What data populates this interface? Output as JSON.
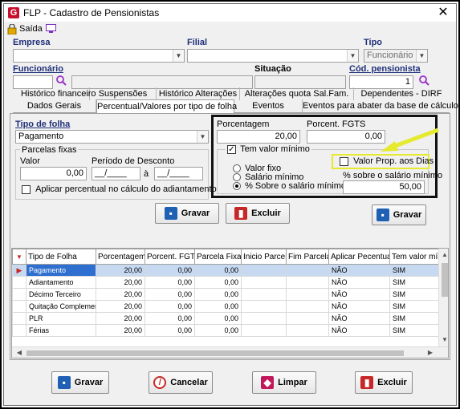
{
  "window": {
    "title": "FLP - Cadastro de Pensionistas",
    "app_icon": "G",
    "close": "✕"
  },
  "toolbar": {
    "exit_label": "Saída"
  },
  "header": {
    "empresa_label": "Empresa",
    "filial_label": "Filial",
    "tipo_label": "Tipo",
    "tipo_value": "Funcionário",
    "funcionario_label": "Funcionário",
    "situacao_label": "Situação",
    "cod_pensionista_label": "Cód. pensionista",
    "cod_pensionista_value": "1"
  },
  "tabs_row1": [
    "Histórico financeiro",
    "Suspensões",
    "Histórico Alterações",
    "Alterações quota Sal.Fam.",
    "Dependentes - DIRF"
  ],
  "tabs_row2": [
    "Dados Gerais",
    "Percentual/Valores por tipo de folha",
    "Eventos",
    "Eventos para abater da base de cálculo"
  ],
  "form": {
    "tipo_folha_label": "Tipo de folha",
    "tipo_folha_value": "Pagamento",
    "parcelas_fixas_label": "Parcelas fixas",
    "valor_label": "Valor",
    "valor_value": "0,00",
    "periodo_label": "Período de Desconto",
    "periodo_de": "__/____",
    "periodo_sep": "à",
    "periodo_ate": "__/____",
    "aplicar_percentual_label": "Aplicar percentual no cálculo do adiantamento",
    "porcentagem_label": "Porcentagem",
    "porcentagem_value": "20,00",
    "porcent_fgts_label": "Porcent. FGTS",
    "porcent_fgts_value": "0,00",
    "tem_valor_minimo_label": "Tem valor mínimo",
    "valor_fixo_label": "Valor fixo",
    "salario_minimo_label": "Salário mínimo",
    "pct_sobre_salario_label": "% Sobre o salário mínimo",
    "valor_prop_dias_label": "Valor Prop. aos Dias",
    "pct_sobre_salario_minimo_label": "% sobre o salário mínimo",
    "pct_sobre_salario_minimo_value": "50,00",
    "gravar_label": "Gravar",
    "excluir_label": "Excluir",
    "gravar2_label": "Gravar"
  },
  "grid": {
    "columns": [
      "Tipo de Folha",
      "Porcentagem",
      "Porcent. FGTS",
      "Parcela Fixa",
      "Inicio Parcela",
      "Fim Parcela",
      "Aplicar Pecentual",
      "Tem valor mín"
    ],
    "rows": [
      [
        "Pagamento",
        "20,00",
        "0,00",
        "0,00",
        "",
        "",
        "NÃO",
        "SIM"
      ],
      [
        "Adiantamento",
        "20,00",
        "0,00",
        "0,00",
        "",
        "",
        "NÃO",
        "SIM"
      ],
      [
        "Décimo Terceiro",
        "20,00",
        "0,00",
        "0,00",
        "",
        "",
        "NÃO",
        "SIM"
      ],
      [
        "Quitação Complementar",
        "20,00",
        "0,00",
        "0,00",
        "",
        "",
        "NÃO",
        "SIM"
      ],
      [
        "PLR",
        "20,00",
        "0,00",
        "0,00",
        "",
        "",
        "NÃO",
        "SIM"
      ],
      [
        "Férias",
        "20,00",
        "0,00",
        "0,00",
        "",
        "",
        "NÃO",
        "SIM"
      ]
    ]
  },
  "footer": {
    "gravar_label": "Gravar",
    "cancelar_label": "Cancelar",
    "limpar_label": "Limpar",
    "excluir_label": "Excluir"
  },
  "colors": {
    "highlight_box": "#111111",
    "callout": "#e6ea2f",
    "selected_row": "#c7d9f1",
    "brand": "#c8102e"
  }
}
